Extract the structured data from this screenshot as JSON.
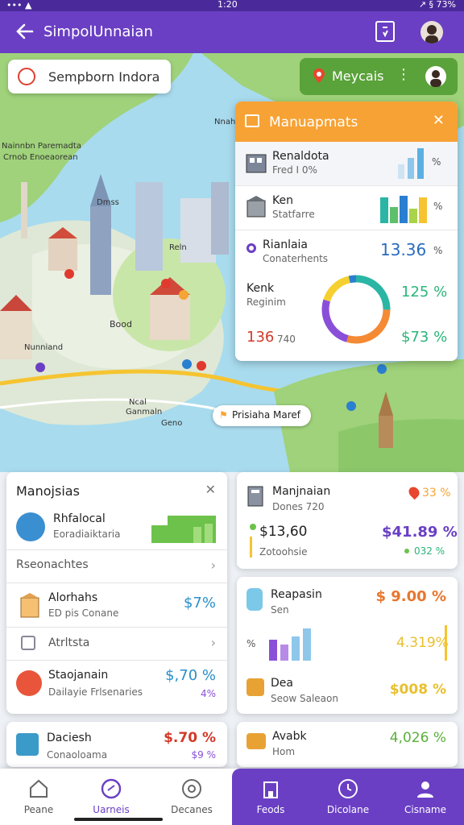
{
  "status": {
    "left": "••• ▲",
    "time": "1:20",
    "right": "↗ § 73%"
  },
  "appbar": {
    "title": "SimpolUnnaian",
    "back_icon": "arrow-left-icon",
    "action_icon": "clipboard-icon"
  },
  "search": {
    "placeholder": "Sempborn Indora"
  },
  "map": {
    "labels": [
      "Nainnbn Paremadta",
      "Crnob Enoeaorean",
      "Dmss",
      "Nnahn",
      "Reln",
      "Nunniand",
      "Ncal",
      "Ganmaln",
      "Geno",
      "Bood"
    ],
    "location_chip": "Prisiaha Maref"
  },
  "map_chip": {
    "label": "Meycais",
    "more": "⋮"
  },
  "management": {
    "title": "Manuapmats",
    "rows": [
      {
        "title": "Renaldota",
        "sub": "Fred I 0%",
        "val": "",
        "extra": "%"
      },
      {
        "title": "Ken",
        "sub": "Statfarre",
        "val": "",
        "extra": "%"
      },
      {
        "title": "Rianlaia",
        "sub": "Conaterhents",
        "val": "13.36",
        "extra": "%"
      },
      {
        "title": "Kenk",
        "sub": "Reginim",
        "val": "125 %",
        "extra": ""
      },
      {
        "title": "136",
        "sub": "740",
        "val": "$73 %",
        "extra": ""
      }
    ],
    "bars1": [
      0.35,
      0.55,
      0.9
    ],
    "bars2": [
      0.8,
      0.55,
      0.95,
      0.5,
      0.9
    ]
  },
  "card_left": {
    "title": "Manojsias",
    "item1": {
      "title": "Rhfalocal",
      "sub": "Eoradiaiktaria"
    },
    "section": "Rseonachtes",
    "item2": {
      "title": "Alorhahs",
      "sub": "ED pis Conane",
      "val": "$7%"
    },
    "section2": "Atrltsta",
    "item3": {
      "title": "Staojanain",
      "sub": "Dailayie Frlsenaries",
      "val": "$,70 %",
      "small": "4%"
    }
  },
  "card_right": {
    "title": "Manjnaian",
    "sub": "Dones 720",
    "badge": "33 %",
    "val1": "$13,60",
    "val1_sub": "Zotoohsie",
    "val2": "$41.89 %",
    "val2_sub": "032 %",
    "item2": {
      "title": "Reapasin",
      "sub": "Sen",
      "val": "$ 9.00 %"
    },
    "chart_label": "%",
    "bars": [
      0.55,
      0.45,
      0.7,
      0.95
    ],
    "pct": "4.319%",
    "item3": {
      "title": "Dea",
      "sub": "Seow Saleaon",
      "val": "$008 %"
    }
  },
  "card_bottom_left": {
    "title": "Daciesh",
    "sub": "Conaoloama",
    "val": "$.70 %",
    "small": "$9 %"
  },
  "card_bottom_right": {
    "title": "Avabk",
    "sub": "Hom",
    "val": "4,026 %"
  },
  "nav": [
    {
      "label": "Peane",
      "icon": "home-icon"
    },
    {
      "label": "Uarneis",
      "icon": "compass-icon"
    },
    {
      "label": "Decanes",
      "icon": "globe-icon"
    },
    {
      "label": "Feods",
      "icon": "building-icon"
    },
    {
      "label": "Dicolane",
      "icon": "clock-icon"
    },
    {
      "label": "Cisname",
      "icon": "user-icon"
    }
  ],
  "colors": {
    "purple": "#6a3fc4",
    "orange": "#f7a234",
    "green": "#5aa23a",
    "blue": "#2a7fd0",
    "red": "#d23a2a"
  }
}
